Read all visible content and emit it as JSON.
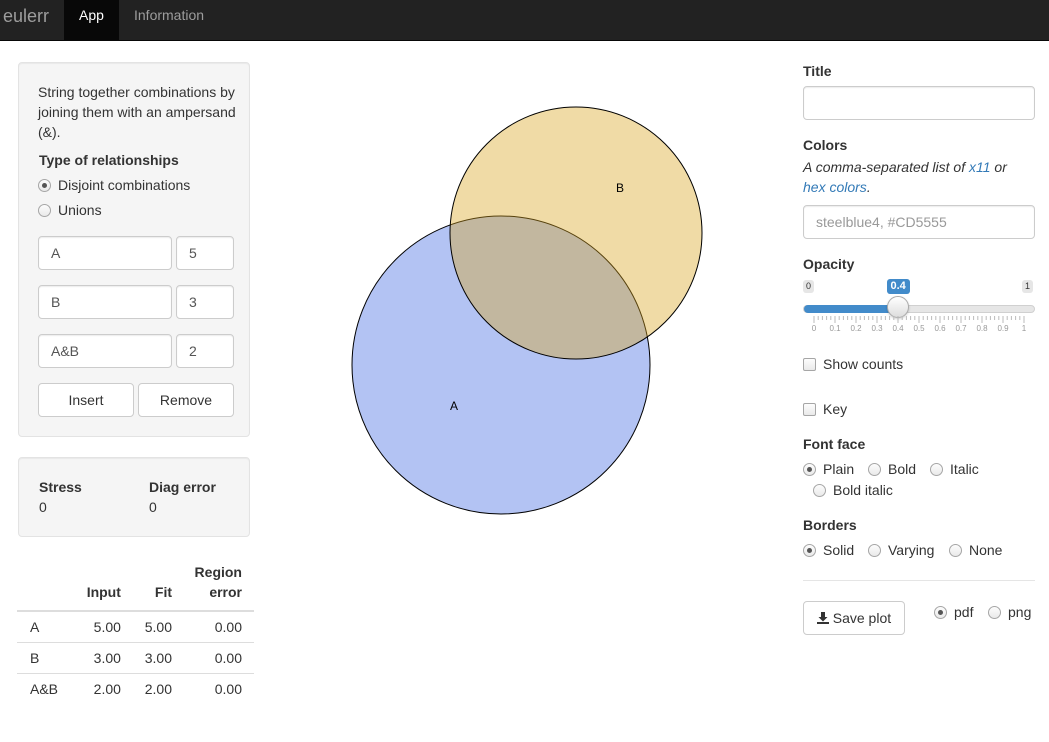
{
  "navbar": {
    "brand": "eulerr",
    "tabs": [
      {
        "label": "App",
        "active": true
      },
      {
        "label": "Information",
        "active": false
      }
    ]
  },
  "input_panel": {
    "help_text": "String together combinations by joining them with an ampersand (&).",
    "relationship_label": "Type of relationships",
    "relationship_options": [
      {
        "label": "Disjoint combinations",
        "selected": true
      },
      {
        "label": "Unions",
        "selected": false
      }
    ],
    "rows": [
      {
        "combo": "A",
        "value": "5"
      },
      {
        "combo": "B",
        "value": "3"
      },
      {
        "combo": "A&B",
        "value": "2"
      }
    ],
    "insert_label": "Insert",
    "remove_label": "Remove"
  },
  "stats": {
    "stress_label": "Stress",
    "stress_value": "0",
    "diag_label": "Diag error",
    "diag_value": "0"
  },
  "fit_table": {
    "headers": [
      "",
      "Input",
      "Fit",
      "Region error"
    ],
    "rows": [
      [
        "A",
        "5.00",
        "5.00",
        "0.00"
      ],
      [
        "B",
        "3.00",
        "3.00",
        "0.00"
      ],
      [
        "A&B",
        "2.00",
        "2.00",
        "0.00"
      ]
    ]
  },
  "plot": {
    "sets": [
      {
        "label": "A",
        "color": "#4169E1"
      },
      {
        "label": "B",
        "color": "#DAA520"
      }
    ],
    "opacity": 0.4
  },
  "options": {
    "title_label": "Title",
    "title_value": "",
    "colors_label": "Colors",
    "colors_help_prefix": "A comma-separated list of ",
    "colors_help_link1": "x11",
    "colors_help_mid": " or",
    "colors_help_link2": "hex colors",
    "colors_help_suffix": ".",
    "colors_placeholder": "steelblue4, #CD5555",
    "opacity_label": "Opacity",
    "opacity_min": "0",
    "opacity_max": "1",
    "opacity_value": "0.4",
    "opacity_ticks": [
      "0",
      "0.1",
      "0.2",
      "0.3",
      "0.4",
      "0.5",
      "0.6",
      "0.7",
      "0.8",
      "0.9",
      "1"
    ],
    "show_counts_label": "Show counts",
    "key_label": "Key",
    "font_face_label": "Font face",
    "font_faces": [
      {
        "label": "Plain",
        "selected": true
      },
      {
        "label": "Bold",
        "selected": false
      },
      {
        "label": "Italic",
        "selected": false
      },
      {
        "label": "Bold italic",
        "selected": false
      }
    ],
    "borders_label": "Borders",
    "borders": [
      {
        "label": "Solid",
        "selected": true
      },
      {
        "label": "Varying",
        "selected": false
      },
      {
        "label": "None",
        "selected": false
      }
    ],
    "save_label": "Save plot",
    "formats": [
      {
        "label": "pdf",
        "selected": true
      },
      {
        "label": "png",
        "selected": false
      }
    ]
  }
}
